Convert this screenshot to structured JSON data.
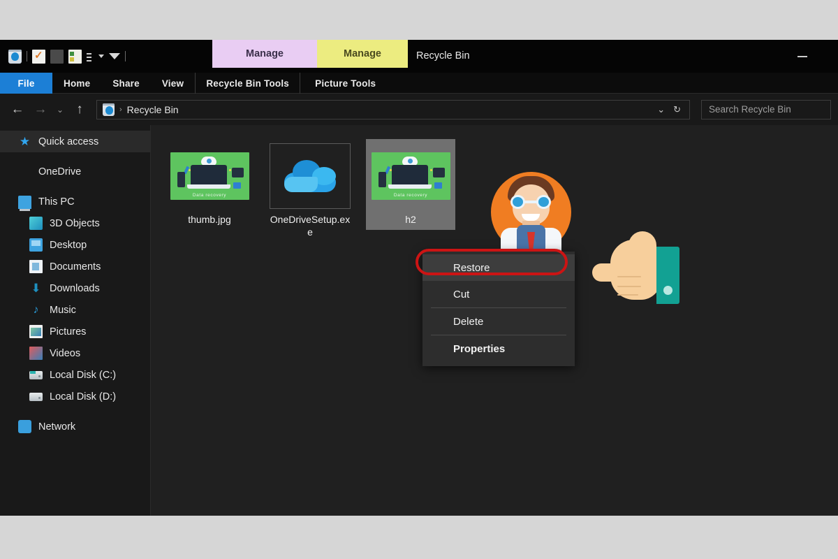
{
  "window": {
    "title": "Recycle Bin",
    "minimize_label": "Minimize",
    "contextual_tabs": [
      {
        "label": "Manage",
        "group": "Recycle Bin Tools",
        "color": "#e9cdf3"
      },
      {
        "label": "Manage",
        "group": "Picture Tools",
        "color": "#ecec80"
      }
    ],
    "quick_access_toolbar": [
      {
        "name": "recycle-bin-icon"
      },
      {
        "name": "properties-icon"
      },
      {
        "name": "blank-icon"
      },
      {
        "name": "view-list-icon"
      },
      {
        "name": "customize-dropdown-icon"
      }
    ]
  },
  "ribbon": {
    "tabs": [
      {
        "label": "File",
        "active": true
      },
      {
        "label": "Home",
        "active": false
      },
      {
        "label": "Share",
        "active": false
      },
      {
        "label": "View",
        "active": false
      },
      {
        "label": "Recycle Bin Tools",
        "active": false
      },
      {
        "label": "Picture Tools",
        "active": false
      }
    ]
  },
  "address_bar": {
    "back_label": "←",
    "forward_label": "→",
    "recent_label": "⌄",
    "up_label": "↑",
    "crumb_separator": "›",
    "breadcrumb": "Recycle Bin",
    "dropdown_label": "⌄",
    "refresh_label": "↻",
    "search_placeholder": "Search Recycle Bin"
  },
  "sidebar": {
    "items": [
      {
        "label": "Quick access",
        "icon": "star-icon",
        "indent": false,
        "selected": true
      },
      {
        "label": "OneDrive",
        "icon": "cloud-icon",
        "indent": false,
        "selected": false
      },
      {
        "label": "This PC",
        "icon": "this-pc-icon",
        "indent": false,
        "selected": false
      },
      {
        "label": "3D Objects",
        "icon": "3d-objects-icon",
        "indent": true,
        "selected": false
      },
      {
        "label": "Desktop",
        "icon": "desktop-icon",
        "indent": true,
        "selected": false
      },
      {
        "label": "Documents",
        "icon": "documents-icon",
        "indent": true,
        "selected": false
      },
      {
        "label": "Downloads",
        "icon": "downloads-icon",
        "indent": true,
        "selected": false
      },
      {
        "label": "Music",
        "icon": "music-icon",
        "indent": true,
        "selected": false
      },
      {
        "label": "Pictures",
        "icon": "pictures-icon",
        "indent": true,
        "selected": false
      },
      {
        "label": "Videos",
        "icon": "videos-icon",
        "indent": true,
        "selected": false
      },
      {
        "label": "Local Disk (C:)",
        "icon": "disk-c-icon",
        "indent": true,
        "selected": false
      },
      {
        "label": "Local Disk (D:)",
        "icon": "disk-d-icon",
        "indent": true,
        "selected": false
      },
      {
        "label": "Network",
        "icon": "network-icon",
        "indent": false,
        "selected": false
      }
    ]
  },
  "files": [
    {
      "name": "thumb.jpg",
      "type": "image",
      "caption": "Data recovery",
      "selected": false,
      "boxed": false
    },
    {
      "name": "OneDriveSetup.exe",
      "type": "executable",
      "selected": false,
      "boxed": true
    },
    {
      "name": "h2",
      "type": "image",
      "caption": "Data recovery",
      "selected": true,
      "boxed": false
    }
  ],
  "context_menu": {
    "items": [
      {
        "label": "Restore",
        "highlighted": true,
        "bold": false,
        "separator_after": false
      },
      {
        "label": "Cut",
        "highlighted": false,
        "bold": false,
        "separator_after": true
      },
      {
        "label": "Delete",
        "highlighted": false,
        "bold": false,
        "separator_after": true
      },
      {
        "label": "Properties",
        "highlighted": false,
        "bold": true,
        "separator_after": false
      }
    ],
    "highlight_color": "#cc1414"
  },
  "overlay": {
    "avatar_name": "scientist-avatar",
    "hand_name": "pointing-hand-cursor"
  }
}
